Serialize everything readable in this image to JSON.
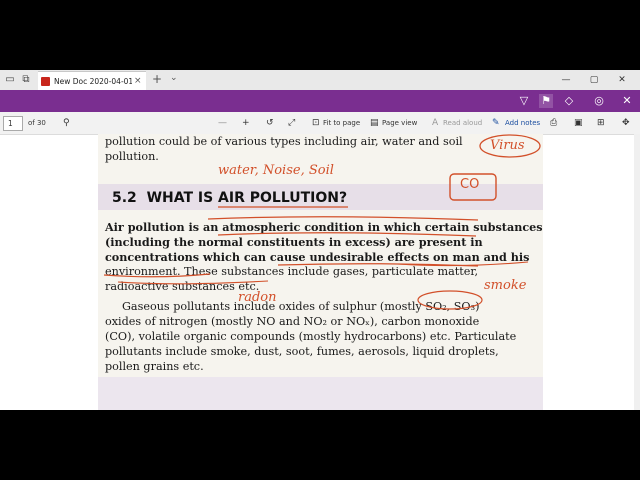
{
  "window": {
    "tab_title": "New Doc 2020-04-01 1t",
    "close_tab": "×",
    "new_tab": "+",
    "tab_menu": "⌄",
    "controls": {
      "minimize": "—",
      "maximize": "▢",
      "close": "✕"
    }
  },
  "ink_toolbar": {
    "icons": [
      "pen-icon",
      "highlighter-icon",
      "eraser-icon",
      "touch-writing-icon",
      "close-icon"
    ]
  },
  "toolbar": {
    "page_number": "1",
    "page_total": "of 30",
    "fit_label": "Fit to page",
    "view_label": "Page view",
    "read_aloud_label": "Read aloud",
    "notes_label": "Add notes"
  },
  "document": {
    "line_top": "pollution could be of various types including air, water and soil",
    "line_top2": "pollution.",
    "section_number": "5.2",
    "section_title": "WHAT IS AIR POLLUTION?",
    "para1": [
      "Air pollution is an atmospheric condition in which certain substances",
      "(including the normal constituents in excess) are present in",
      "concentrations which can cause undesirable effects on man and his",
      "environment. These substances include gases, particulate matter,",
      "radioactive substances etc."
    ],
    "para2": [
      "Gaseous pollutants include oxides of sulphur (mostly SO₂, SO₃)",
      "oxides of nitrogen (mostly NO and NO₂ or NOₓ), carbon monoxide",
      "(CO), volatile organic compounds (mostly hydrocarbons) etc. Particulate",
      "pollutants include smoke, dust, soot, fumes, aerosols, liquid droplets,",
      "pollen grains etc."
    ]
  },
  "annotations": {
    "ink_words": "water, Noise, Soil",
    "ink_co": "CO",
    "ink_virus": "Virus",
    "ink_smoke": "smoke",
    "ink_radon": "radon"
  },
  "colors": {
    "purple_bar": "#7a2e90",
    "ink": "#d2502a",
    "link_blue": "#1c4fa0"
  }
}
